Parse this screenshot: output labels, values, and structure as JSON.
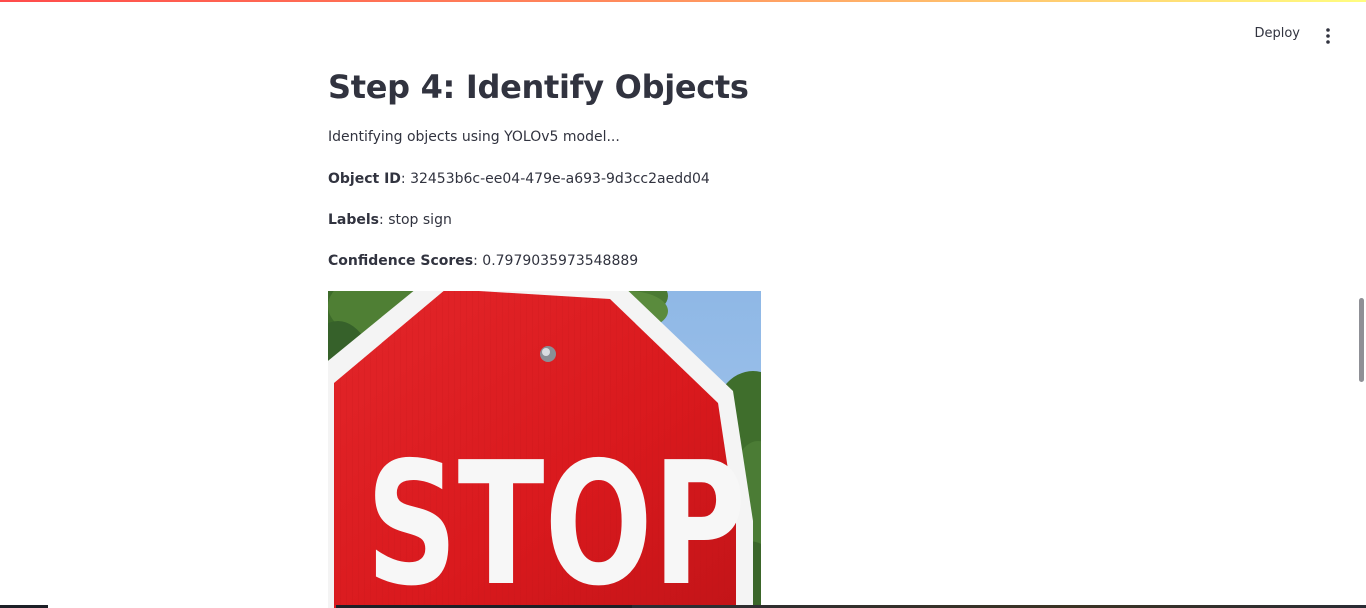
{
  "header": {
    "deploy_label": "Deploy",
    "menu_icon": "more-vertical-icon"
  },
  "main": {
    "title": "Step 4: Identify Objects",
    "status_text": "Identifying objects using YOLOv5 model...",
    "object_id_label": "Object ID",
    "object_id_value": ": 32453b6c-ee04-479e-a693-9d3cc2aedd04",
    "labels_label": "Labels",
    "labels_value": ": stop sign",
    "confidence_label": "Confidence Scores",
    "confidence_value": ": 0.7979035973548889",
    "image_sign_text": "STOP"
  },
  "colors": {
    "accent": "#ff4b4b",
    "text": "#31333f",
    "sign_red": "#d9191d",
    "sky": "#8fb8e6"
  }
}
